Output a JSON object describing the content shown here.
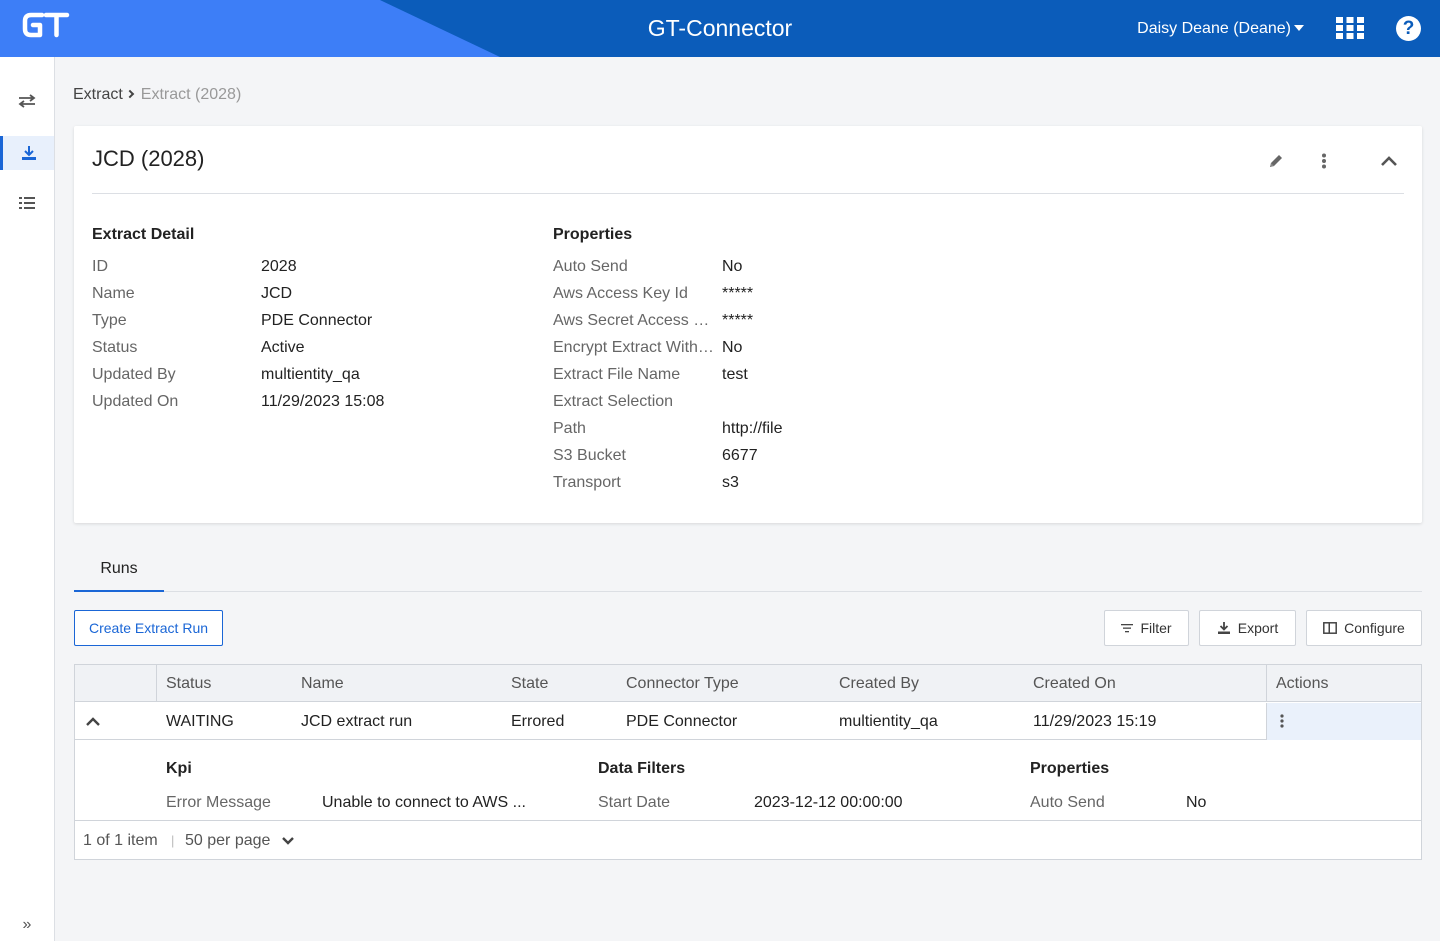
{
  "header": {
    "logo_text": "GT",
    "app_title": "GT-Connector",
    "user_label": "Daisy Deane (Deane)",
    "help_label": "?"
  },
  "sidebar": {
    "items": [
      {
        "icon": "swap-arrows-icon",
        "active": false
      },
      {
        "icon": "download-icon",
        "active": true
      },
      {
        "icon": "list-icon",
        "active": false
      }
    ],
    "expand_icon": "double-chevron-right-icon",
    "expand_label": "»"
  },
  "breadcrumb": {
    "parent": "Extract",
    "current": "Extract (2028)"
  },
  "card": {
    "title": "JCD (2028)",
    "extract_detail": {
      "heading": "Extract Detail",
      "fields": [
        {
          "key": "ID",
          "value": "2028"
        },
        {
          "key": "Name",
          "value": "JCD"
        },
        {
          "key": "Type",
          "value": "PDE Connector"
        },
        {
          "key": "Status",
          "value": "Active"
        },
        {
          "key": "Updated By",
          "value": "multientity_qa"
        },
        {
          "key": "Updated On",
          "value": "11/29/2023 15:08"
        }
      ]
    },
    "properties": {
      "heading": "Properties",
      "fields": [
        {
          "key": "Auto Send",
          "value": "No"
        },
        {
          "key": "Aws Access Key Id",
          "value": "*****"
        },
        {
          "key": "Aws Secret Access K...",
          "value": "*****"
        },
        {
          "key": "Encrypt Extract With ...",
          "value": "No"
        },
        {
          "key": "Extract File Name",
          "value": "test"
        },
        {
          "key": "Extract Selection",
          "value": ""
        },
        {
          "key": "Path",
          "value": "http://file"
        },
        {
          "key": "S3 Bucket",
          "value": "6677"
        },
        {
          "key": "Transport",
          "value": "s3"
        }
      ]
    }
  },
  "tabs": [
    {
      "label": "Runs",
      "active": true
    }
  ],
  "toolbar": {
    "create_label": "Create Extract Run",
    "filter_label": "Filter",
    "export_label": "Export",
    "configure_label": "Configure"
  },
  "table": {
    "columns": [
      "Status",
      "Name",
      "State",
      "Connector Type",
      "Created By",
      "Created On",
      "Actions"
    ],
    "rows": [
      {
        "status": "WAITING",
        "name": "JCD extract run",
        "state": "Errored",
        "connector_type": "PDE Connector",
        "created_by": "multientity_qa",
        "created_on": "11/29/2023 15:19",
        "detail": {
          "kpi": {
            "heading": "Kpi",
            "key": "Error Message",
            "value": "Unable to connect to AWS ..."
          },
          "data_filters": {
            "heading": "Data Filters",
            "key": "Start Date",
            "value": "2023-12-12 00:00:00"
          },
          "properties": {
            "heading": "Properties",
            "key": "Auto Send",
            "value": "No"
          }
        }
      }
    ],
    "pager": {
      "summary": "1 of 1 item",
      "separator": "|",
      "per_page": "50 per page"
    }
  },
  "colors": {
    "header_dark": "#0b5cba",
    "header_light": "#3d7ef7",
    "accent": "#1a66d6"
  }
}
